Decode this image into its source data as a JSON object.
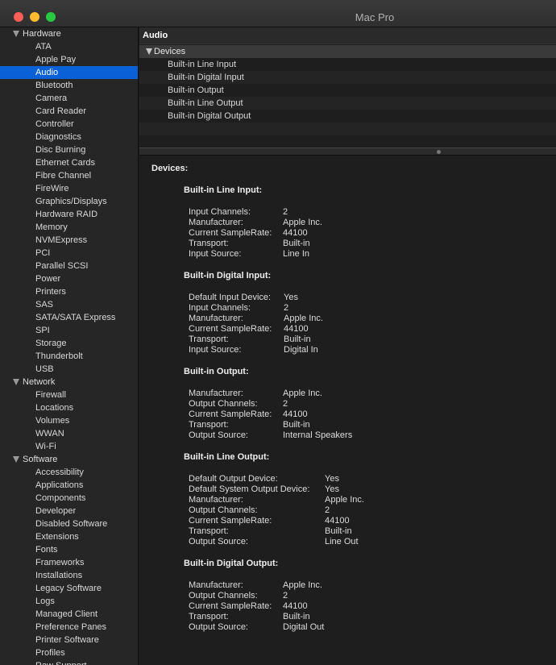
{
  "window": {
    "title": "Mac Pro"
  },
  "sidebar": {
    "rows": [
      {
        "kind": "cat",
        "label": "Hardware"
      },
      {
        "kind": "item",
        "label": "ATA"
      },
      {
        "kind": "item",
        "label": "Apple Pay"
      },
      {
        "kind": "item",
        "label": "Audio",
        "selected": true
      },
      {
        "kind": "item",
        "label": "Bluetooth"
      },
      {
        "kind": "item",
        "label": "Camera"
      },
      {
        "kind": "item",
        "label": "Card Reader"
      },
      {
        "kind": "item",
        "label": "Controller"
      },
      {
        "kind": "item",
        "label": "Diagnostics"
      },
      {
        "kind": "item",
        "label": "Disc Burning"
      },
      {
        "kind": "item",
        "label": "Ethernet Cards"
      },
      {
        "kind": "item",
        "label": "Fibre Channel"
      },
      {
        "kind": "item",
        "label": "FireWire"
      },
      {
        "kind": "item",
        "label": "Graphics/Displays"
      },
      {
        "kind": "item",
        "label": "Hardware RAID"
      },
      {
        "kind": "item",
        "label": "Memory"
      },
      {
        "kind": "item",
        "label": "NVMExpress"
      },
      {
        "kind": "item",
        "label": "PCI"
      },
      {
        "kind": "item",
        "label": "Parallel SCSI"
      },
      {
        "kind": "item",
        "label": "Power"
      },
      {
        "kind": "item",
        "label": "Printers"
      },
      {
        "kind": "item",
        "label": "SAS"
      },
      {
        "kind": "item",
        "label": "SATA/SATA Express"
      },
      {
        "kind": "item",
        "label": "SPI"
      },
      {
        "kind": "item",
        "label": "Storage"
      },
      {
        "kind": "item",
        "label": "Thunderbolt"
      },
      {
        "kind": "item",
        "label": "USB"
      },
      {
        "kind": "cat",
        "label": "Network"
      },
      {
        "kind": "item",
        "label": "Firewall"
      },
      {
        "kind": "item",
        "label": "Locations"
      },
      {
        "kind": "item",
        "label": "Volumes"
      },
      {
        "kind": "item",
        "label": "WWAN"
      },
      {
        "kind": "item",
        "label": "Wi-Fi"
      },
      {
        "kind": "cat",
        "label": "Software"
      },
      {
        "kind": "item",
        "label": "Accessibility"
      },
      {
        "kind": "item",
        "label": "Applications"
      },
      {
        "kind": "item",
        "label": "Components"
      },
      {
        "kind": "item",
        "label": "Developer"
      },
      {
        "kind": "item",
        "label": "Disabled Software"
      },
      {
        "kind": "item",
        "label": "Extensions"
      },
      {
        "kind": "item",
        "label": "Fonts"
      },
      {
        "kind": "item",
        "label": "Frameworks"
      },
      {
        "kind": "item",
        "label": "Installations"
      },
      {
        "kind": "item",
        "label": "Legacy Software"
      },
      {
        "kind": "item",
        "label": "Logs"
      },
      {
        "kind": "item",
        "label": "Managed Client"
      },
      {
        "kind": "item",
        "label": "Preference Panes"
      },
      {
        "kind": "item",
        "label": "Printer Software"
      },
      {
        "kind": "item",
        "label": "Profiles"
      },
      {
        "kind": "item",
        "label": "Raw Support"
      }
    ]
  },
  "content": {
    "section_title": "Audio",
    "list_header": "Devices",
    "device_list": [
      "Built-in Line Input",
      "Built-in Digital Input",
      "Built-in Output",
      "Built-in Line Output",
      "Built-in Digital Output"
    ]
  },
  "detail": {
    "heading": "Devices:",
    "devices": [
      {
        "name": "Built-in Line Input:",
        "props": [
          {
            "k": "Input Channels:",
            "v": "2"
          },
          {
            "k": "Manufacturer:",
            "v": "Apple Inc."
          },
          {
            "k": "Current SampleRate:",
            "v": "44100"
          },
          {
            "k": "Transport:",
            "v": "Built-in"
          },
          {
            "k": "Input Source:",
            "v": "Line In"
          }
        ]
      },
      {
        "name": "Built-in Digital Input:",
        "props": [
          {
            "k": "Default Input Device:",
            "v": "Yes"
          },
          {
            "k": "Input Channels:",
            "v": "2"
          },
          {
            "k": "Manufacturer:",
            "v": "Apple Inc."
          },
          {
            "k": "Current SampleRate:",
            "v": "44100"
          },
          {
            "k": "Transport:",
            "v": "Built-in"
          },
          {
            "k": "Input Source:",
            "v": "Digital In"
          }
        ]
      },
      {
        "name": "Built-in Output:",
        "props": [
          {
            "k": "Manufacturer:",
            "v": "Apple Inc."
          },
          {
            "k": "Output Channels:",
            "v": "2"
          },
          {
            "k": "Current SampleRate:",
            "v": "44100"
          },
          {
            "k": "Transport:",
            "v": "Built-in"
          },
          {
            "k": "Output Source:",
            "v": "Internal Speakers"
          }
        ]
      },
      {
        "name": "Built-in Line Output:",
        "props": [
          {
            "k": "Default Output Device:",
            "v": "Yes"
          },
          {
            "k": "Default System Output Device:",
            "v": "Yes"
          },
          {
            "k": "Manufacturer:",
            "v": "Apple Inc."
          },
          {
            "k": "Output Channels:",
            "v": "2"
          },
          {
            "k": "Current SampleRate:",
            "v": "44100"
          },
          {
            "k": "Transport:",
            "v": "Built-in"
          },
          {
            "k": "Output Source:",
            "v": "Line Out"
          }
        ]
      },
      {
        "name": "Built-in Digital Output:",
        "props": [
          {
            "k": "Manufacturer:",
            "v": "Apple Inc."
          },
          {
            "k": "Output Channels:",
            "v": "2"
          },
          {
            "k": "Current SampleRate:",
            "v": "44100"
          },
          {
            "k": "Transport:",
            "v": "Built-in"
          },
          {
            "k": "Output Source:",
            "v": "Digital Out"
          }
        ]
      }
    ]
  }
}
